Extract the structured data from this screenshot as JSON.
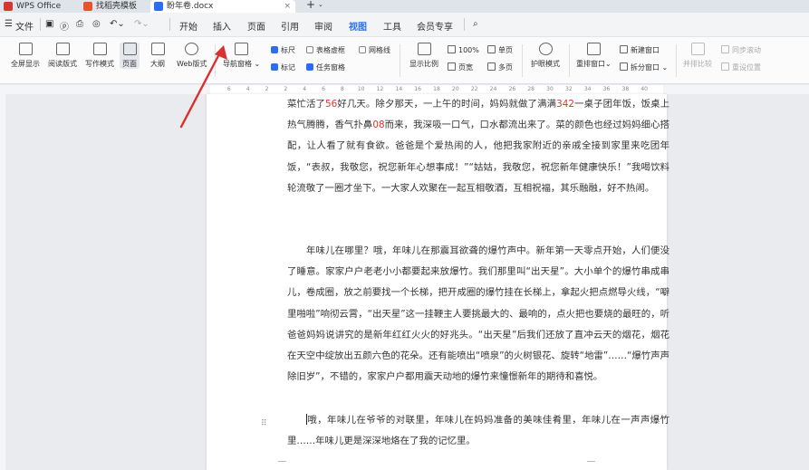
{
  "titlebar": {
    "tabs": [
      {
        "label": "WPS Office",
        "color": "#d9352f"
      },
      {
        "label": "找稻壳模板",
        "color": "#e8532c"
      },
      {
        "label": "盼年卷.docx",
        "color": "#2b6ef3"
      }
    ],
    "new_tab": "+"
  },
  "menubar": {
    "file": "文件",
    "items": [
      "开始",
      "插入",
      "页面",
      "引用",
      "审阅",
      "视图",
      "工具",
      "会员专享"
    ],
    "active_index": 5
  },
  "ribbon": {
    "buttons": [
      "全屏显示",
      "阅读版式",
      "写作模式",
      "页面",
      "大纲",
      "Web版式",
      "导航窗格",
      "显示比例",
      "护眼模式",
      "重排窗口",
      "拆分窗口",
      "并排比较",
      "重设位置"
    ],
    "checks": [
      {
        "label": "标尺",
        "on": true
      },
      {
        "label": "表格虚框",
        "on": false
      },
      {
        "label": "网格线",
        "on": false
      },
      {
        "label": "标记",
        "on": true
      },
      {
        "label": "任务窗格",
        "on": true
      }
    ],
    "zoom_label": "100%",
    "page_width": "页宽",
    "single_page": "单页",
    "multi_page": "多页",
    "new_window": "新建窗口",
    "sync_scroll": "同步滚动",
    "reset_position": "重设位置"
  },
  "ruler": {
    "marks": [
      "6",
      "4",
      "2",
      "2",
      "4",
      "6",
      "8",
      "10",
      "12",
      "14",
      "16",
      "18",
      "20",
      "22",
      "24",
      "26",
      "28",
      "30",
      "32",
      "34",
      "36",
      "38",
      "40"
    ]
  },
  "document": {
    "para1": [
      {
        "t": "菜忙活了"
      },
      {
        "t": "56",
        "num": true
      },
      {
        "t": "好几天。除夕那天，一上午的时间，妈妈就做了满满"
      },
      {
        "t": "342",
        "num": true
      },
      {
        "t": "一桌子团年饭，饭桌上热气腾腾，香气扑鼻"
      },
      {
        "t": "08",
        "num": true
      },
      {
        "t": "而来，我深吸一口气，口水都流出来了。菜的颜色也经过妈妈细心搭配，让人看了就有食欲。爸爸是个爱热闹的人，他把我家附近的亲戚全接到家里来吃团年饭，“表叔，我敬您，祝您新年心想事成！”“姑姑，我敬您，祝您新年健康快乐！”我喝饮料轮流敬了一圈才坐下。一大家人欢聚在一起互相敬酒，互相祝福，其乐融融，好不热闹。"
      }
    ],
    "para2": "年味儿在哪里？哦，年味儿在那震耳欲聋的爆竹声中。新年第一天零点开始，人们便没了睡意。家家户户老老小小都要起来放爆竹。我们那里叫“出天星”。大小单个的爆竹串成串儿，卷成圈，放之前要找一个长梯，把开成圈的爆竹挂在长梯上，拿起火把点燃导火线，“噼里啪啦”响彻云霄，“出天星”这一挂鞭主人要挑最大的、最响的，点火把也要烧的最旺的，听爸爸妈妈说讲究的是新年红红火火的好兆头。“出天星”后我们还放了直冲云天的烟花，烟花在天空中绽放出五颜六色的花朵。还有能喷出“喷泉”的火树银花、旋转“地雷”……“爆竹声声除旧岁”，不错的，家家户户都用震天动地的爆竹来憧憬新年的期待和喜悦。",
    "para3": "哦，年味儿在爷爷的对联里，年味儿在妈妈准备的美味佳肴里，年味儿在一声声爆竹里……年味儿更是深深地烙在了我的记忆里。"
  },
  "colors": {
    "accent": "#2b6ef3",
    "number_highlight": "#e0342b",
    "arrow": "#d93030"
  }
}
